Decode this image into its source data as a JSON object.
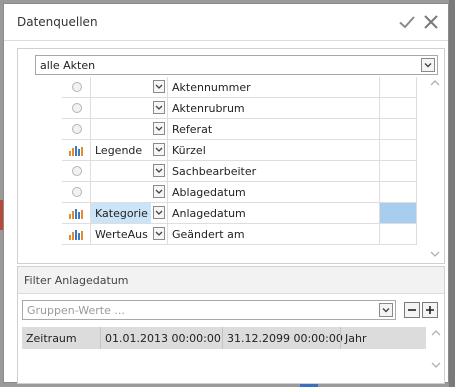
{
  "dialog": {
    "title": "Datenquellen",
    "ok_icon": "checkmark-icon",
    "close_icon": "close-icon"
  },
  "source_combo": {
    "value": "alle Akten",
    "icon": "chevron-down-icon"
  },
  "fields": [
    {
      "icon": "radio-icon",
      "aggregation": "",
      "name": "Aktennummer",
      "selected": false
    },
    {
      "icon": "radio-icon",
      "aggregation": "",
      "name": "Aktenrubrum",
      "selected": false
    },
    {
      "icon": "radio-icon",
      "aggregation": "",
      "name": "Referat",
      "selected": false
    },
    {
      "icon": "bar-chart-icon",
      "aggregation": "Legende",
      "name": "Kürzel",
      "selected": false
    },
    {
      "icon": "radio-icon",
      "aggregation": "",
      "name": "Sachbearbeiter",
      "selected": false
    },
    {
      "icon": "radio-icon",
      "aggregation": "",
      "name": "Ablagedatum",
      "selected": false
    },
    {
      "icon": "bar-chart-icon",
      "aggregation": "Kategorie",
      "name": "Anlagedatum",
      "selected": true
    },
    {
      "icon": "bar-chart-icon",
      "aggregation": "WerteAus",
      "name": "Geändert am",
      "selected": false
    }
  ],
  "colors": {
    "selection": "#cce4f7",
    "selection_extra": "#a9cdef",
    "filter_row": "#dcdcdc",
    "bar_orange": "#e8892b",
    "bar_blue": "#3a79c9"
  },
  "filter": {
    "title": "Filter Anlagedatum",
    "group_placeholder": "Gruppen-Werte ...",
    "minus_label": "−",
    "plus_label": "+",
    "row": {
      "label": "Zeitraum",
      "from": "01.01.2013 00:00:00",
      "to": "31.12.2099 00:00:00",
      "unit": "Jahr"
    }
  }
}
